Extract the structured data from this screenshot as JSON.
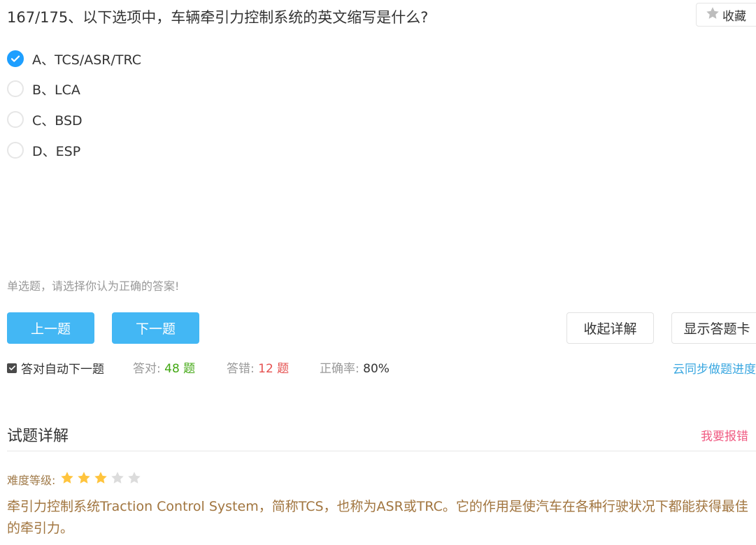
{
  "question": {
    "title": "167/175、以下选项中，车辆牵引力控制系统的英文缩写是什么?",
    "favorite_label": "收藏"
  },
  "options": [
    {
      "label": "A、TCS/ASR/TRC",
      "selected": true
    },
    {
      "label": "B、LCA",
      "selected": false
    },
    {
      "label": "C、BSD",
      "selected": false
    },
    {
      "label": "D、ESP",
      "selected": false
    }
  ],
  "hint": "单选题，请选择你认为正确的答案!",
  "buttons": {
    "prev": "上一题",
    "next": "下一题",
    "collapse_detail": "收起详解",
    "show_answer_card": "显示答题卡"
  },
  "auto_next": {
    "label": "答对自动下一题",
    "checked": true
  },
  "stats": {
    "correct_label": "答对:",
    "correct_value": "48 题",
    "wrong_label": "答错:",
    "wrong_value": "12 题",
    "accuracy_label": "正确率:",
    "accuracy_value": "80%"
  },
  "sync_link": "云同步做题进度",
  "detail": {
    "section_title": "试题详解",
    "report_label": "我要报错",
    "difficulty_label": "难度等级:",
    "difficulty_rating": 3,
    "difficulty_max": 5,
    "explanation": "牵引力控制系统Traction Control System，简称TCS，也称为ASR或TRC。它的作用是使汽车在各种行驶状况下都能获得最佳的牵引力。"
  },
  "colors": {
    "accent_blue": "#43b7f4",
    "radio_checked": "#1e9fff",
    "correct_green": "#43a814",
    "wrong_red": "#e5504f",
    "star_filled": "#ffc43d",
    "star_empty": "#dcdcdc",
    "report_pink": "#f05a82"
  }
}
